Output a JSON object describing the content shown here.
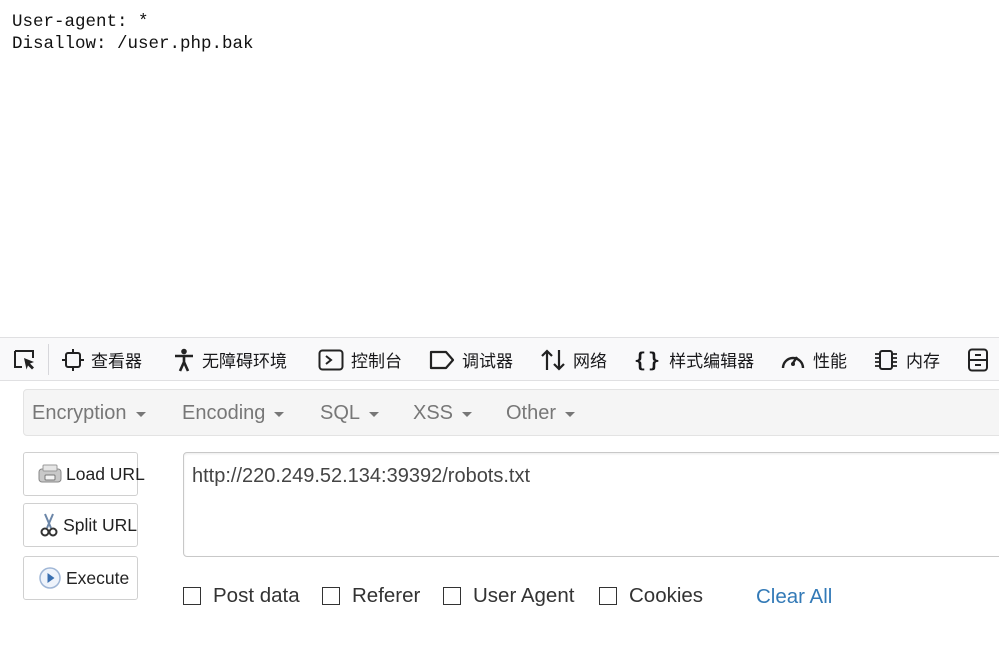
{
  "page": {
    "lines": [
      "User-agent: *",
      "Disallow: /user.php.bak"
    ]
  },
  "devtools": {
    "tabs": [
      {
        "icon": "pick-element-icon",
        "label": ""
      },
      {
        "icon": "inspector-icon",
        "label": "查看器"
      },
      {
        "icon": "accessibility-icon",
        "label": "无障碍环境"
      },
      {
        "icon": "console-icon",
        "label": "控制台"
      },
      {
        "icon": "debugger-icon",
        "label": "调试器"
      },
      {
        "icon": "network-icon",
        "label": "网络"
      },
      {
        "icon": "style-editor-icon",
        "label": "样式编辑器"
      },
      {
        "icon": "performance-icon",
        "label": "性能"
      },
      {
        "icon": "memory-icon",
        "label": "内存"
      },
      {
        "icon": "storage-icon",
        "label": ""
      }
    ]
  },
  "hackbar": {
    "menu": [
      "Encryption",
      "Encoding",
      "SQL",
      "XSS",
      "Other"
    ],
    "buttons": {
      "load_url": "Load URL",
      "split_url": "Split URL",
      "execute": "Execute"
    },
    "url": "http://220.249.52.134:39392/robots.txt",
    "options": {
      "post_data": "Post data",
      "referer": "Referer",
      "user_agent": "User Agent",
      "cookies": "Cookies",
      "clear_all": "Clear All"
    },
    "colors": {
      "link": "#337ab7",
      "menu_text": "#777777"
    }
  }
}
